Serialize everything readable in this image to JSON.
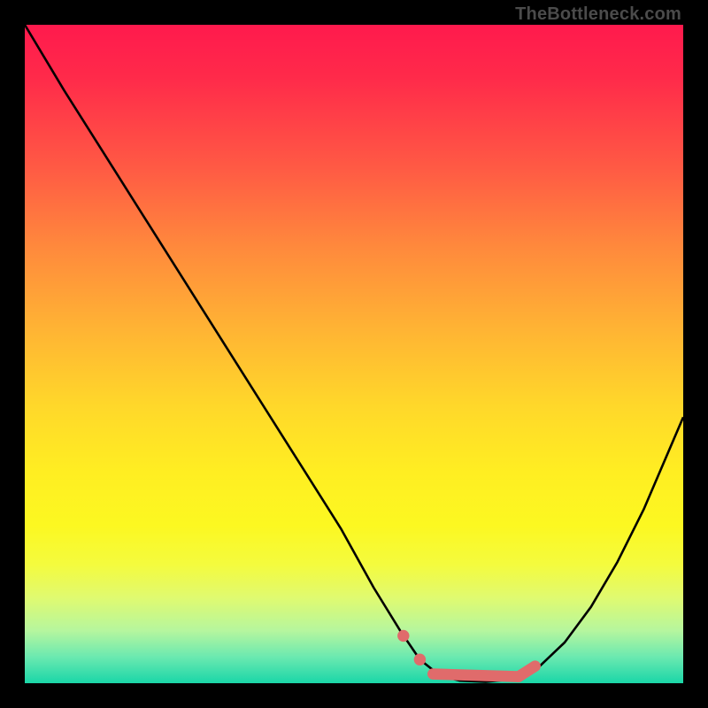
{
  "watermark": "TheBottleneck.com",
  "chart_data": {
    "type": "line",
    "title": "",
    "xlabel": "",
    "ylabel": "",
    "xlim": [
      0,
      100
    ],
    "ylim": [
      0,
      100
    ],
    "grid": false,
    "series": [
      {
        "name": "bottleneck-curve",
        "x": [
          0,
          6,
          12,
          18,
          24,
          30,
          36,
          42,
          48,
          53,
          57,
          60,
          63,
          66,
          70,
          74,
          78,
          82,
          86,
          90,
          94,
          100
        ],
        "y": [
          100,
          90,
          80.5,
          71,
          61.5,
          52,
          42.5,
          33,
          23.5,
          14.5,
          8,
          3.6,
          1.2,
          0.4,
          0.2,
          0.6,
          2.4,
          6.2,
          11.6,
          18.4,
          26.4,
          40.4
        ]
      }
    ],
    "markers": [
      {
        "name": "dot-left-upper",
        "x": 57.5,
        "y": 7.2,
        "r": 0.9
      },
      {
        "name": "dot-left-lower",
        "x": 60.0,
        "y": 3.6,
        "r": 0.9
      },
      {
        "name": "flat-segment-start",
        "x": 62.0,
        "y": 1.4
      },
      {
        "name": "flat-segment-end",
        "x": 75.0,
        "y": 1.0
      },
      {
        "name": "right-tail-end",
        "x": 77.5,
        "y": 2.6
      }
    ],
    "marker_color": "#e06b6b",
    "marker_stroke_width": 1.7,
    "curve_color": "#000000",
    "curve_width": 0.35,
    "background_gradient": {
      "stops": [
        {
          "pos": 0,
          "color": "#ff1a4d"
        },
        {
          "pos": 50,
          "color": "#ffd200"
        },
        {
          "pos": 100,
          "color": "#1ad6a8"
        }
      ]
    }
  }
}
